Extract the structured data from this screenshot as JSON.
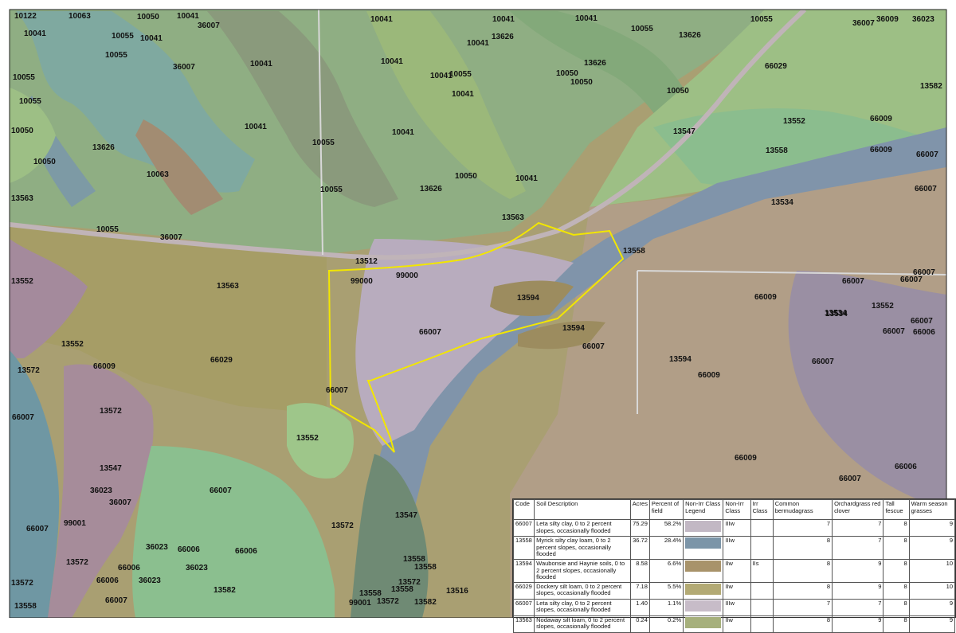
{
  "map": {
    "soil_labels": [
      "10122",
      "10063",
      "10050",
      "10041",
      "10041",
      "36007",
      "10041",
      "10041",
      "10055",
      "10041",
      "10055",
      "13626",
      "10041",
      "36009",
      "36023",
      "10041",
      "10055",
      "36007",
      "10041",
      "13626",
      "10055",
      "10041",
      "10050",
      "10050",
      "10055",
      "10041",
      "10041",
      "13582",
      "10041",
      "10055",
      "36007",
      "10055",
      "13626",
      "10050",
      "66029",
      "13547",
      "13552",
      "66009",
      "66009",
      "10055",
      "13626",
      "10050",
      "10063",
      "10055",
      "10041",
      "10050",
      "13626",
      "10041",
      "13558",
      "66007",
      "66007",
      "13563",
      "10050",
      "13563",
      "13534",
      "10055",
      "36007",
      "13512",
      "13558",
      "99000",
      "99000",
      "13552",
      "13563",
      "66007",
      "13594",
      "66009",
      "66007",
      "13594",
      "13534",
      "66007",
      "66007",
      "13552",
      "13572",
      "66009",
      "66029",
      "66007",
      "13594",
      "66007",
      "66007",
      "66007",
      "66006",
      "13534",
      "13552",
      "66007",
      "66009",
      "13572",
      "66009",
      "13552",
      "66007",
      "36023",
      "66007",
      "36007",
      "66007",
      "99001",
      "13547",
      "66006",
      "13547",
      "13572",
      "36023",
      "66006",
      "66006",
      "66007",
      "13572",
      "36023",
      "13572",
      "66006",
      "66006",
      "36023",
      "66007",
      "13582",
      "13558",
      "13572",
      "13558",
      "13582",
      "99001",
      "13516",
      "13558",
      "13558",
      "13572",
      "13558"
    ],
    "colors": {
      "field_boundary": "#f2e600",
      "railway": "#c0b4b8",
      "road": "#d8d8d8"
    }
  },
  "legend": {
    "headers": [
      "Code",
      "Soil Description",
      "Acres",
      "Percent of field",
      "Non-Irr Class Legend",
      "Non-Irr Class",
      "Irr Class",
      "Common bermudagrass",
      "Orchardgrass red clover",
      "Tall fescue",
      "Warm season grasses"
    ],
    "rows": [
      {
        "code": "66007",
        "description": "Leta silty clay, 0 to 2 percent slopes, occasionally flooded",
        "acres": "75.29",
        "percent": "58.2%",
        "swatch": "#c2b8c4",
        "nonirr": "IIIw",
        "irr": "",
        "bermuda": "7",
        "orchard": "7",
        "fescue": "8",
        "warm": "9"
      },
      {
        "code": "13558",
        "description": "Myrick silty clay loam, 0 to 2 percent slopes, occasionally flooded",
        "acres": "36.72",
        "percent": "28.4%",
        "swatch": "#7c95a8",
        "nonirr": "IIIw",
        "irr": "",
        "bermuda": "8",
        "orchard": "7",
        "fescue": "8",
        "warm": "9"
      },
      {
        "code": "13594",
        "description": "Waubonsie and Haynie soils, 0 to 2 percent slopes, occasionally flooded",
        "acres": "8.58",
        "percent": "6.6%",
        "swatch": "#a8936a",
        "nonirr": "IIw",
        "irr": "IIs",
        "bermuda": "8",
        "orchard": "9",
        "fescue": "8",
        "warm": "10"
      },
      {
        "code": "66029",
        "description": "Dockery silt loam, 0 to 2 percent slopes, occasionally flooded",
        "acres": "7.18",
        "percent": "5.5%",
        "swatch": "#b3aa74",
        "nonirr": "IIw",
        "irr": "",
        "bermuda": "8",
        "orchard": "9",
        "fescue": "8",
        "warm": "10"
      },
      {
        "code": "66007",
        "description": "Leta silty clay, 0 to 2 percent slopes, occasionally flooded",
        "acres": "1.40",
        "percent": "1.1%",
        "swatch": "#c7bcc8",
        "nonirr": "IIIw",
        "irr": "",
        "bermuda": "7",
        "orchard": "7",
        "fescue": "8",
        "warm": "9"
      },
      {
        "code": "13563",
        "description": "Nodaway silt loam, 0 to 2 percent slopes, occasionally flooded",
        "acres": "0.24",
        "percent": "0.2%",
        "swatch": "#a6b07c",
        "nonirr": "IIw",
        "irr": "",
        "bermuda": "8",
        "orchard": "9",
        "fescue": "8",
        "warm": "9"
      }
    ]
  }
}
